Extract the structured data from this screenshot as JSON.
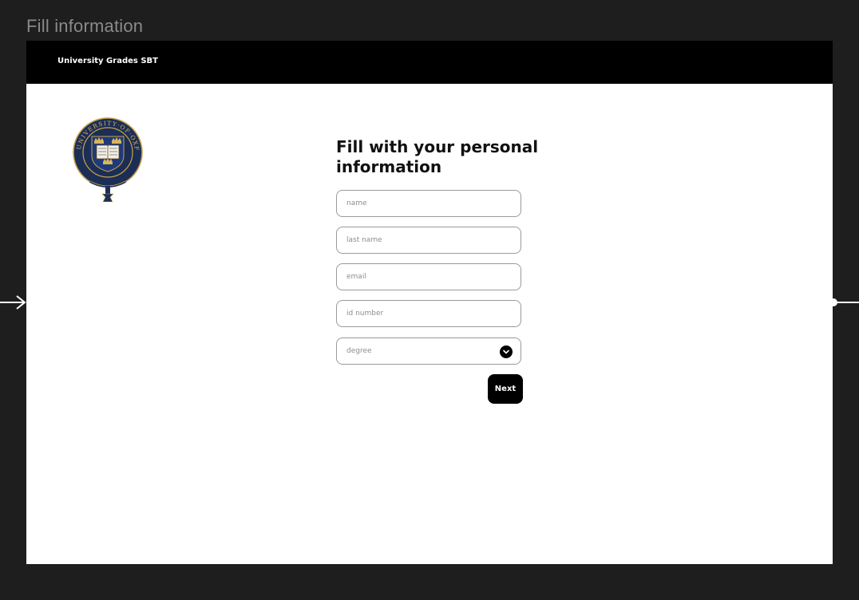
{
  "canvas": {
    "frame_title": "Fill information"
  },
  "topbar": {
    "app_title": "University Grades SBT"
  },
  "crest": {
    "icon": "university-of-oxford-crest",
    "ring_text": "UNIVERSITY OF OXFORD"
  },
  "form": {
    "title": "Fill with your personal information",
    "fields": {
      "name": {
        "placeholder": "name",
        "value": ""
      },
      "last_name": {
        "placeholder": "last name",
        "value": ""
      },
      "email": {
        "placeholder": "email",
        "value": ""
      },
      "id_number": {
        "placeholder": "id number",
        "value": ""
      },
      "degree": {
        "placeholder": "degree",
        "icon": "chevron-down-icon"
      }
    },
    "next_label": "Next"
  },
  "colors": {
    "background": "#1e1e1e",
    "topbar": "#000000",
    "crest_navy": "#1c2e55",
    "crest_gold": "#c9a24a"
  }
}
